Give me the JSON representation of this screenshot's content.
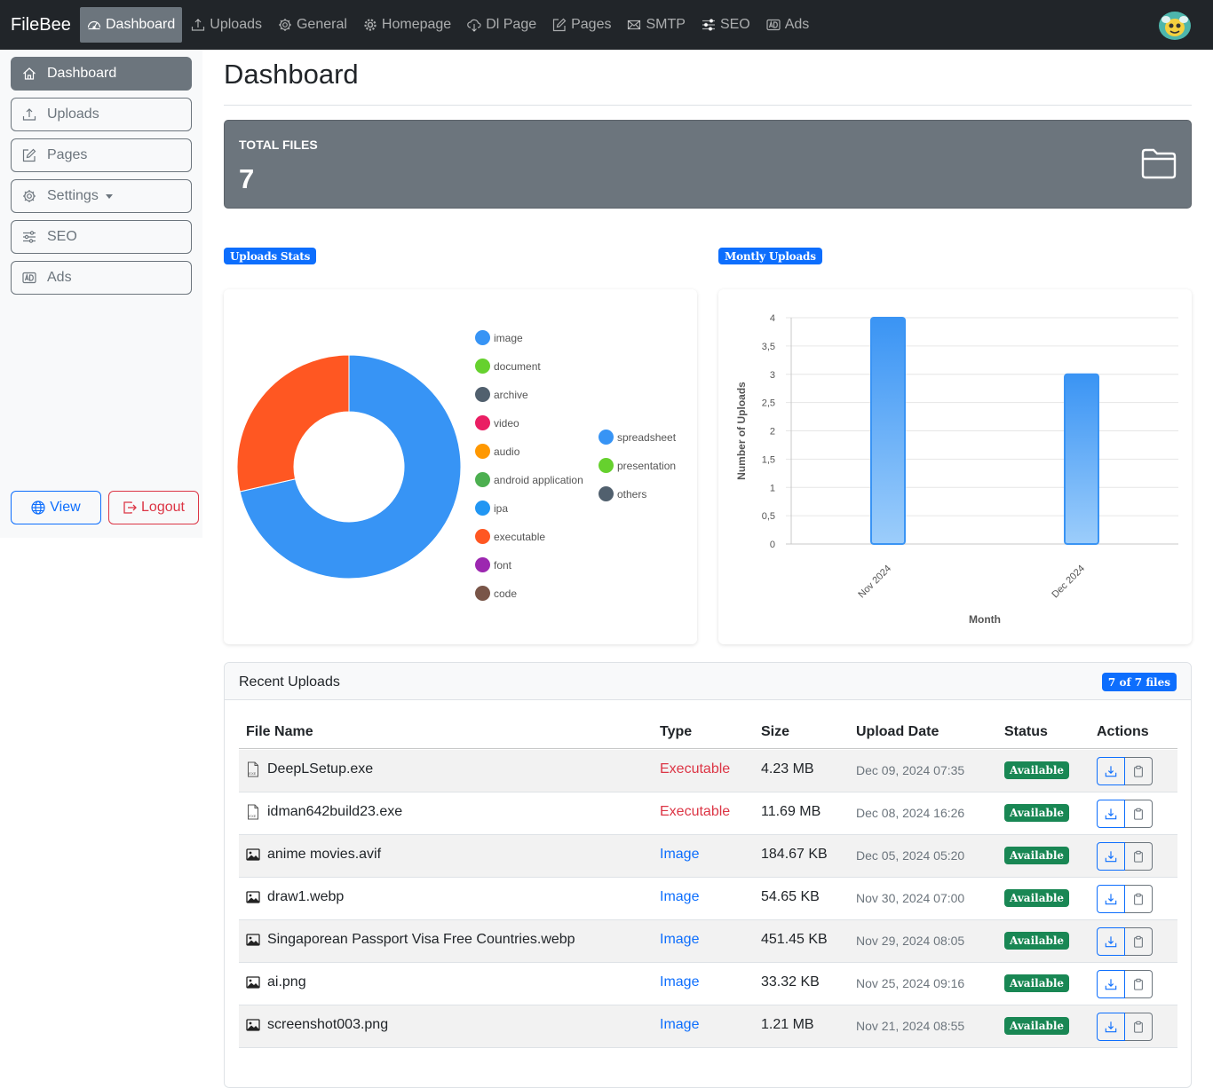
{
  "navbar": {
    "brand": "FileBee",
    "items": [
      {
        "label": "Dashboard",
        "icon": "speedometer-icon",
        "active": true
      },
      {
        "label": "Uploads",
        "icon": "upload-icon"
      },
      {
        "label": "General",
        "icon": "gear-icon"
      },
      {
        "label": "Homepage",
        "icon": "gear-wide-icon"
      },
      {
        "label": "Dl Page",
        "icon": "cloud-download-icon"
      },
      {
        "label": "Pages",
        "icon": "pencil-square-icon"
      },
      {
        "label": "SMTP",
        "icon": "envelope-icon"
      },
      {
        "label": "SEO",
        "icon": "sliders-icon"
      },
      {
        "label": "Ads",
        "icon": "badge-ad-icon"
      }
    ]
  },
  "sidebar": {
    "items": [
      {
        "label": "Dashboard",
        "icon": "house-icon",
        "active": true
      },
      {
        "label": "Uploads",
        "icon": "upload-icon"
      },
      {
        "label": "Pages",
        "icon": "pencil-square-icon"
      },
      {
        "label": "Settings",
        "icon": "gear-icon",
        "dropdown": true
      },
      {
        "label": "SEO",
        "icon": "sliders-icon"
      },
      {
        "label": "Ads",
        "icon": "badge-ad-icon"
      }
    ],
    "view_label": "View",
    "logout_label": "Logout"
  },
  "main": {
    "title": "Dashboard",
    "total_files": {
      "label": "TOTAL FILES",
      "value": "7"
    },
    "uploads_stats_badge": "Uploads Stats",
    "monthly_uploads_badge": "Montly Uploads"
  },
  "chart_data": [
    {
      "type": "pie",
      "title": "",
      "categories": [
        "image",
        "document",
        "archive",
        "video",
        "audio",
        "android application",
        "ipa",
        "executable",
        "font",
        "code",
        "spreadsheet",
        "presentation",
        "others"
      ],
      "values": [
        5,
        0,
        0,
        0,
        0,
        0,
        0,
        2,
        0,
        0,
        0,
        0,
        0
      ],
      "colors": [
        "#3794f5",
        "#66d12e",
        "#51606e",
        "#ea1e63",
        "#ff9800",
        "#4caf50",
        "#2196f3",
        "#ff5722",
        "#9c27b0",
        "#795548",
        "#3794f5",
        "#66d12e",
        "#51606e"
      ],
      "legend": "right"
    },
    {
      "type": "bar",
      "title": "",
      "categories": [
        "Nov 2024",
        "Dec 2024"
      ],
      "values": [
        4,
        3
      ],
      "xlabel": "Month",
      "ylabel": "Number of Uploads",
      "ylim": [
        0,
        4
      ],
      "yticks": [
        "0",
        "0,5",
        "1",
        "1,5",
        "2",
        "2,5",
        "3",
        "3,5",
        "4"
      ],
      "grid": true,
      "color": "#4aa3f8"
    }
  ],
  "recent": {
    "title": "Recent Uploads",
    "count_badge": "7 of 7 files",
    "headers": [
      "File Name",
      "Type",
      "Size",
      "Upload Date",
      "Status",
      "Actions"
    ],
    "rows": [
      {
        "name": "DeepLSetup.exe",
        "type": "Executable",
        "kind": "exe",
        "size": "4.23 MB",
        "date": "Dec 09, 2024 07:35",
        "status": "Available"
      },
      {
        "name": "idman642build23.exe",
        "type": "Executable",
        "kind": "exe",
        "size": "11.69 MB",
        "date": "Dec 08, 2024 16:26",
        "status": "Available"
      },
      {
        "name": "anime movies.avif",
        "type": "Image",
        "kind": "img",
        "size": "184.67 KB",
        "date": "Dec 05, 2024 05:20",
        "status": "Available"
      },
      {
        "name": "draw1.webp",
        "type": "Image",
        "kind": "img",
        "size": "54.65 KB",
        "date": "Nov 30, 2024 07:00",
        "status": "Available"
      },
      {
        "name": "Singaporean Passport Visa Free Countries.webp",
        "type": "Image",
        "kind": "img",
        "size": "451.45 KB",
        "date": "Nov 29, 2024 08:05",
        "status": "Available"
      },
      {
        "name": "ai.png",
        "type": "Image",
        "kind": "img",
        "size": "33.32 KB",
        "date": "Nov 25, 2024 09:16",
        "status": "Available"
      },
      {
        "name": "screenshot003.png",
        "type": "Image",
        "kind": "img",
        "size": "1.21 MB",
        "date": "Nov 21, 2024 08:55",
        "status": "Available"
      }
    ]
  }
}
